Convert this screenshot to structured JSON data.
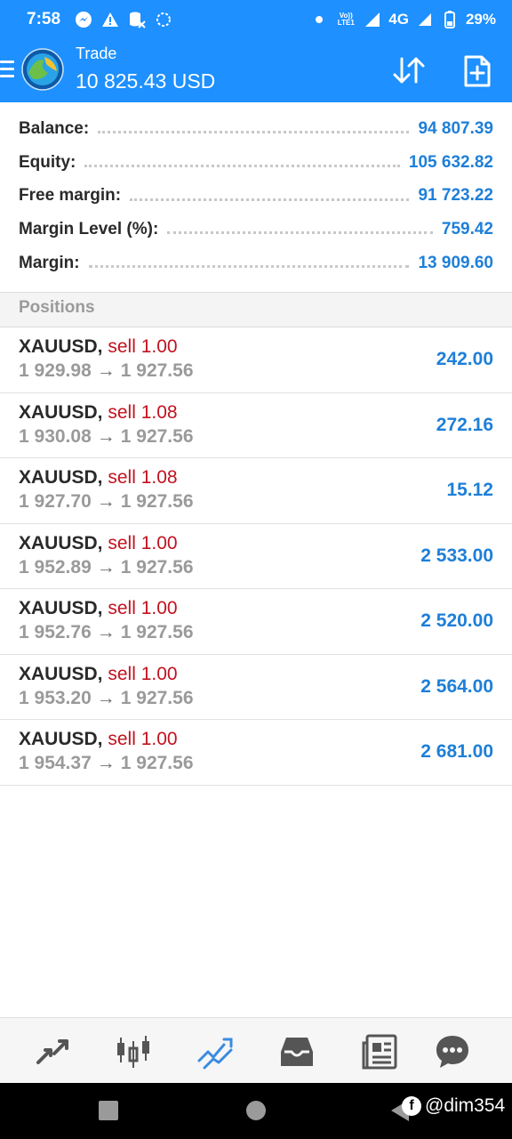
{
  "status_bar": {
    "time": "7:58",
    "network": "4G",
    "volte": "Vo)) LTE1",
    "battery": "29%",
    "left_icons": [
      "messenger-icon",
      "alert-icon",
      "database-icon",
      "sync-icon"
    ]
  },
  "header": {
    "title": "Trade",
    "amount": "10 825.43 USD",
    "color": "#1E90FF"
  },
  "summary": [
    {
      "label": "Balance:",
      "value": "94 807.39"
    },
    {
      "label": "Equity:",
      "value": "105 632.82"
    },
    {
      "label": "Free margin:",
      "value": "91 723.22"
    },
    {
      "label": "Margin Level (%):",
      "value": "759.42"
    },
    {
      "label": "Margin:",
      "value": "13 909.60"
    }
  ],
  "positions_title": "Positions",
  "positions": [
    {
      "symbol": "XAUUSD,",
      "type": "sell 1.00",
      "open": "1 929.98",
      "arrow": "→",
      "current": "1 927.56",
      "profit": "242.00"
    },
    {
      "symbol": "XAUUSD,",
      "type": "sell 1.08",
      "open": "1 930.08",
      "arrow": "→",
      "current": "1 927.56",
      "profit": "272.16"
    },
    {
      "symbol": "XAUUSD,",
      "type": "sell 1.08",
      "open": "1 927.70",
      "arrow": "→",
      "current": "1 927.56",
      "profit": "15.12"
    },
    {
      "symbol": "XAUUSD,",
      "type": "sell 1.00",
      "open": "1 952.89",
      "arrow": "→",
      "current": "1 927.56",
      "profit": "2 533.00"
    },
    {
      "symbol": "XAUUSD,",
      "type": "sell 1.00",
      "open": "1 952.76",
      "arrow": "→",
      "current": "1 927.56",
      "profit": "2 520.00"
    },
    {
      "symbol": "XAUUSD,",
      "type": "sell 1.00",
      "open": "1 953.20",
      "arrow": "→",
      "current": "1 927.56",
      "profit": "2 564.00"
    },
    {
      "symbol": "XAUUSD,",
      "type": "sell 1.00",
      "open": "1 954.37",
      "arrow": "→",
      "current": "1 927.56",
      "profit": "2 681.00"
    }
  ],
  "bottom_nav": [
    "quotes-icon",
    "chart-icon",
    "trade-icon",
    "history-icon",
    "news-icon",
    "chat-icon"
  ],
  "watermark": "@dim354"
}
